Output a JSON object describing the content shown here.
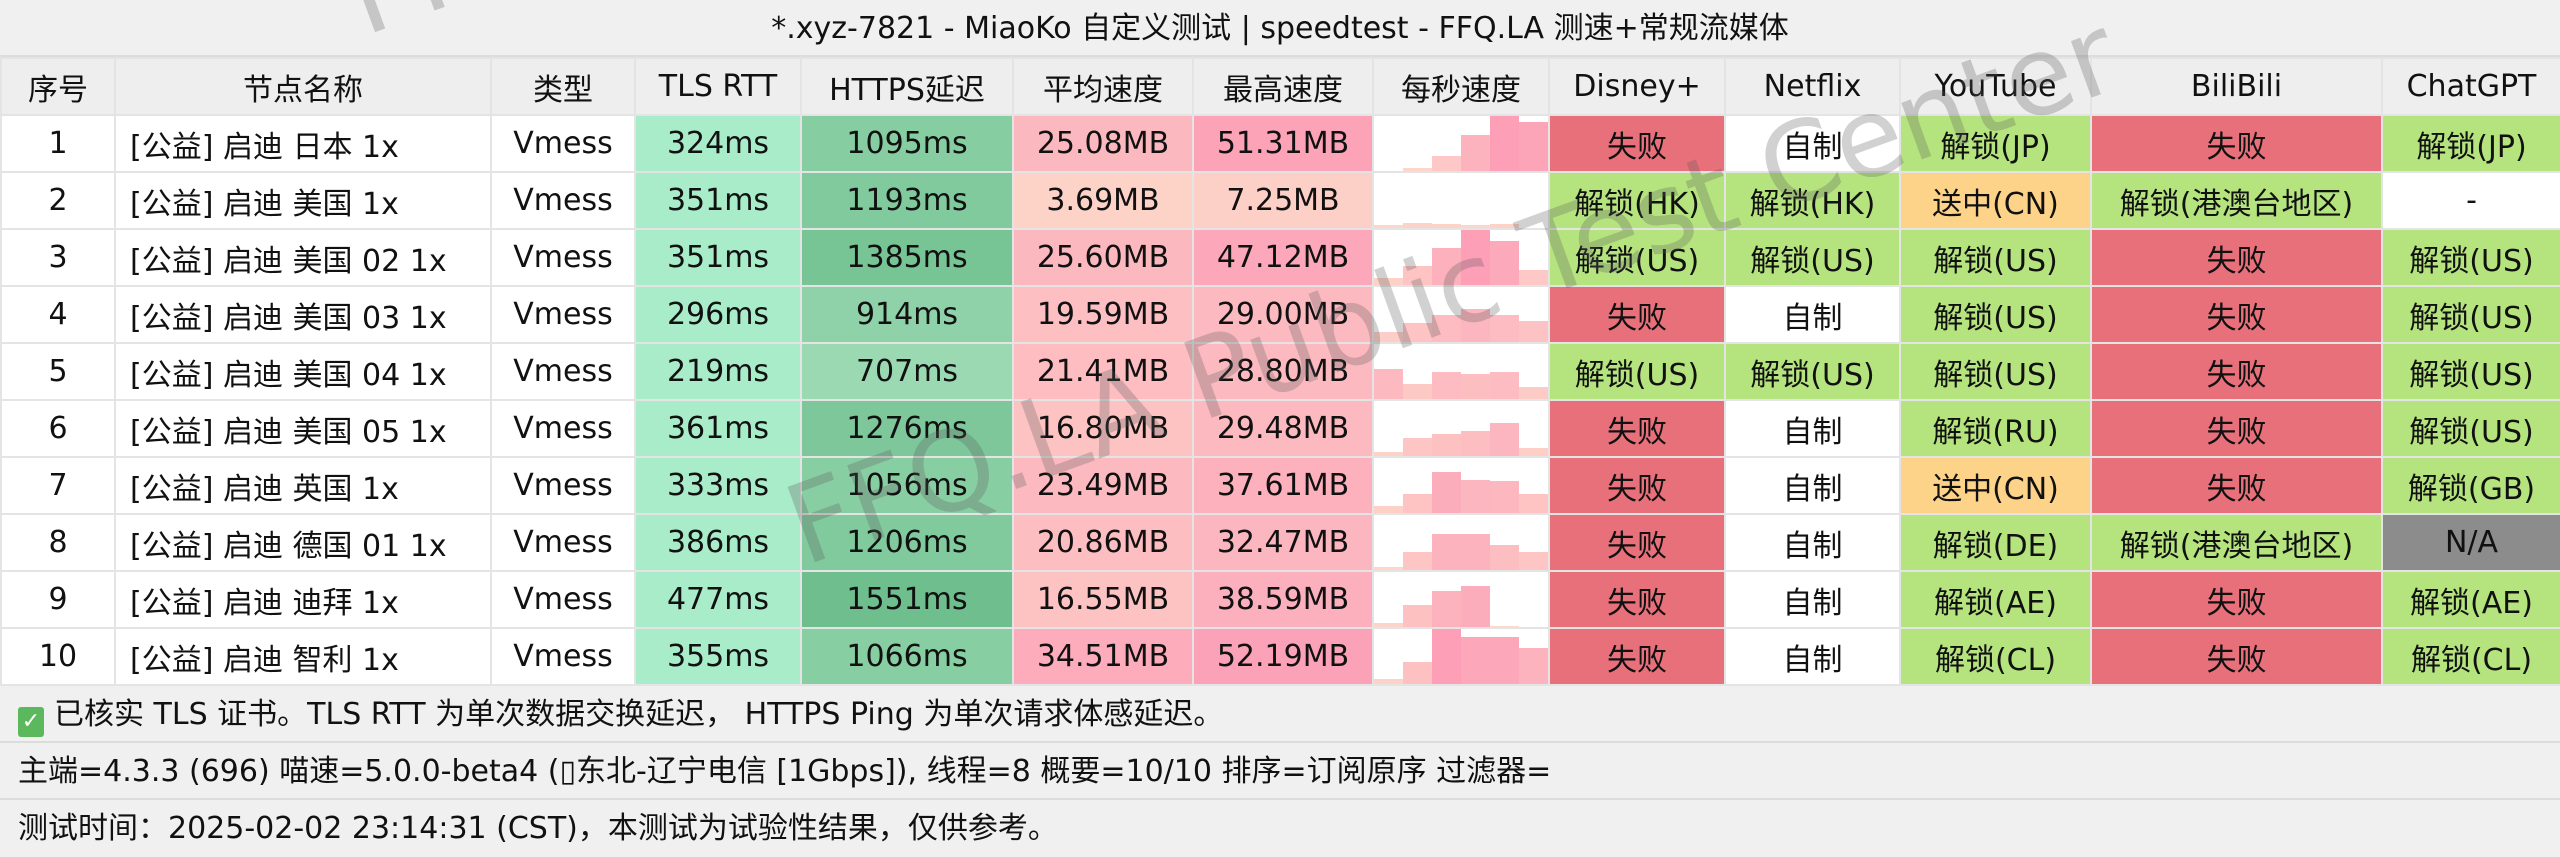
{
  "window": {
    "title": "*.xyz-7821 - MiaoKo 自定义测试 | speedtest - FFQ.LA 测速+常规流媒体"
  },
  "watermark": "FFQ.LA Public Test Center",
  "colors": {
    "fail": "#e8707a",
    "unlock": "#b5e37e",
    "pending": "#fdd38a",
    "na": "#8c8c8c",
    "none": "#ffffff",
    "tls": "#a8ecca",
    "https_low": "#9ad9b2",
    "https_high": "#6fbf8e",
    "speed_low": "#fdd8ca",
    "speed_high": "#fc9fb7"
  },
  "headers": [
    "序号",
    "节点名称",
    "类型",
    "TLS RTT",
    "HTTPS延迟",
    "平均速度",
    "最高速度",
    "每秒速度",
    "Disney+",
    "Netflix",
    "YouTube",
    "BiliBili",
    "ChatGPT"
  ],
  "rows": [
    {
      "idx": "1",
      "name": "[公益] 启迪 日本 1x",
      "type": "Vmess",
      "tls": "324ms",
      "https": "1095ms",
      "avg": "25.08MB",
      "max": "51.31MB",
      "per_second": [
        0,
        0.05,
        0.28,
        0.65,
        1.0,
        0.9
      ],
      "disney": "失败",
      "netflix": "自制",
      "youtube": "解锁(JP)",
      "bilibili": "失败",
      "chatgpt": "解锁(JP)"
    },
    {
      "idx": "2",
      "name": "[公益] 启迪 美国 1x",
      "type": "Vmess",
      "tls": "351ms",
      "https": "1193ms",
      "avg": "3.69MB",
      "max": "7.25MB",
      "per_second": [
        0.05,
        0.1,
        0.08,
        0.05,
        0.08,
        0
      ],
      "disney": "解锁(HK)",
      "netflix": "解锁(HK)",
      "youtube": "送中(CN)",
      "bilibili": "解锁(港澳台地区)",
      "chatgpt": "-"
    },
    {
      "idx": "3",
      "name": "[公益] 启迪 美国 02 1x",
      "type": "Vmess",
      "tls": "351ms",
      "https": "1385ms",
      "avg": "25.60MB",
      "max": "47.12MB",
      "per_second": [
        0.13,
        0.35,
        0.68,
        1.0,
        0.8,
        0.28
      ],
      "disney": "解锁(US)",
      "netflix": "解锁(US)",
      "youtube": "解锁(US)",
      "bilibili": "失败",
      "chatgpt": "解锁(US)"
    },
    {
      "idx": "4",
      "name": "[公益] 启迪 美国 03 1x",
      "type": "Vmess",
      "tls": "296ms",
      "https": "914ms",
      "avg": "19.59MB",
      "max": "29.00MB",
      "per_second": [
        0.18,
        0.35,
        0.5,
        0.6,
        0.5,
        0.38
      ],
      "disney": "失败",
      "netflix": "自制",
      "youtube": "解锁(US)",
      "bilibili": "失败",
      "chatgpt": "解锁(US)"
    },
    {
      "idx": "5",
      "name": "[公益] 启迪 美国 04 1x",
      "type": "Vmess",
      "tls": "219ms",
      "https": "707ms",
      "avg": "21.41MB",
      "max": "28.80MB",
      "per_second": [
        0.55,
        0.27,
        0.5,
        0.45,
        0.5,
        0.22
      ],
      "disney": "解锁(US)",
      "netflix": "解锁(US)",
      "youtube": "解锁(US)",
      "bilibili": "失败",
      "chatgpt": "解锁(US)"
    },
    {
      "idx": "6",
      "name": "[公益] 启迪 美国 05 1x",
      "type": "Vmess",
      "tls": "361ms",
      "https": "1276ms",
      "avg": "16.80MB",
      "max": "29.48MB",
      "per_second": [
        0.08,
        0.32,
        0.4,
        0.45,
        0.6,
        0.15
      ],
      "disney": "失败",
      "netflix": "自制",
      "youtube": "解锁(RU)",
      "bilibili": "失败",
      "chatgpt": "解锁(US)"
    },
    {
      "idx": "7",
      "name": "[公益] 启迪 英国 1x",
      "type": "Vmess",
      "tls": "333ms",
      "https": "1056ms",
      "avg": "23.49MB",
      "max": "37.61MB",
      "per_second": [
        0.12,
        0.35,
        0.75,
        0.6,
        0.58,
        0.35
      ],
      "disney": "失败",
      "netflix": "自制",
      "youtube": "送中(CN)",
      "bilibili": "失败",
      "chatgpt": "解锁(GB)"
    },
    {
      "idx": "8",
      "name": "[公益] 启迪 德国 01 1x",
      "type": "Vmess",
      "tls": "386ms",
      "https": "1206ms",
      "avg": "20.86MB",
      "max": "32.47MB",
      "per_second": [
        0.05,
        0.32,
        0.65,
        0.65,
        0.45,
        0.33
      ],
      "disney": "失败",
      "netflix": "自制",
      "youtube": "解锁(DE)",
      "bilibili": "解锁(港澳台地区)",
      "chatgpt": "N/A"
    },
    {
      "idx": "9",
      "name": "[公益] 启迪 迪拜 1x",
      "type": "Vmess",
      "tls": "477ms",
      "https": "1551ms",
      "avg": "16.55MB",
      "max": "38.59MB",
      "per_second": [
        0.07,
        0.4,
        0.65,
        0.75,
        0.02,
        0
      ],
      "disney": "失败",
      "netflix": "自制",
      "youtube": "解锁(AE)",
      "bilibili": "失败",
      "chatgpt": "解锁(AE)"
    },
    {
      "idx": "10",
      "name": "[公益] 启迪 智利 1x",
      "type": "Vmess",
      "tls": "355ms",
      "https": "1066ms",
      "avg": "34.51MB",
      "max": "52.19MB",
      "per_second": [
        0.1,
        0.4,
        1.0,
        0.85,
        0.85,
        0.65
      ],
      "disney": "失败",
      "netflix": "自制",
      "youtube": "解锁(CL)",
      "bilibili": "失败",
      "chatgpt": "解锁(CL)"
    }
  ],
  "footer": {
    "tls_note": "已核实 TLS 证书。TLS RTT 为单次数据交换延迟， HTTPS Ping 为单次请求体感延迟。",
    "info": "主端=4.3.3 (696) 喵速=5.0.0-beta4 (▯东北-辽宁电信 [1Gbps]), 线程=8 概要=10/10 排序=订阅原序 过滤器=",
    "time": "测试时间：2025-02-02 23:14:31 (CST)，本测试为试验性结果，仅供参考。",
    "check_icon": "check-box-icon"
  }
}
